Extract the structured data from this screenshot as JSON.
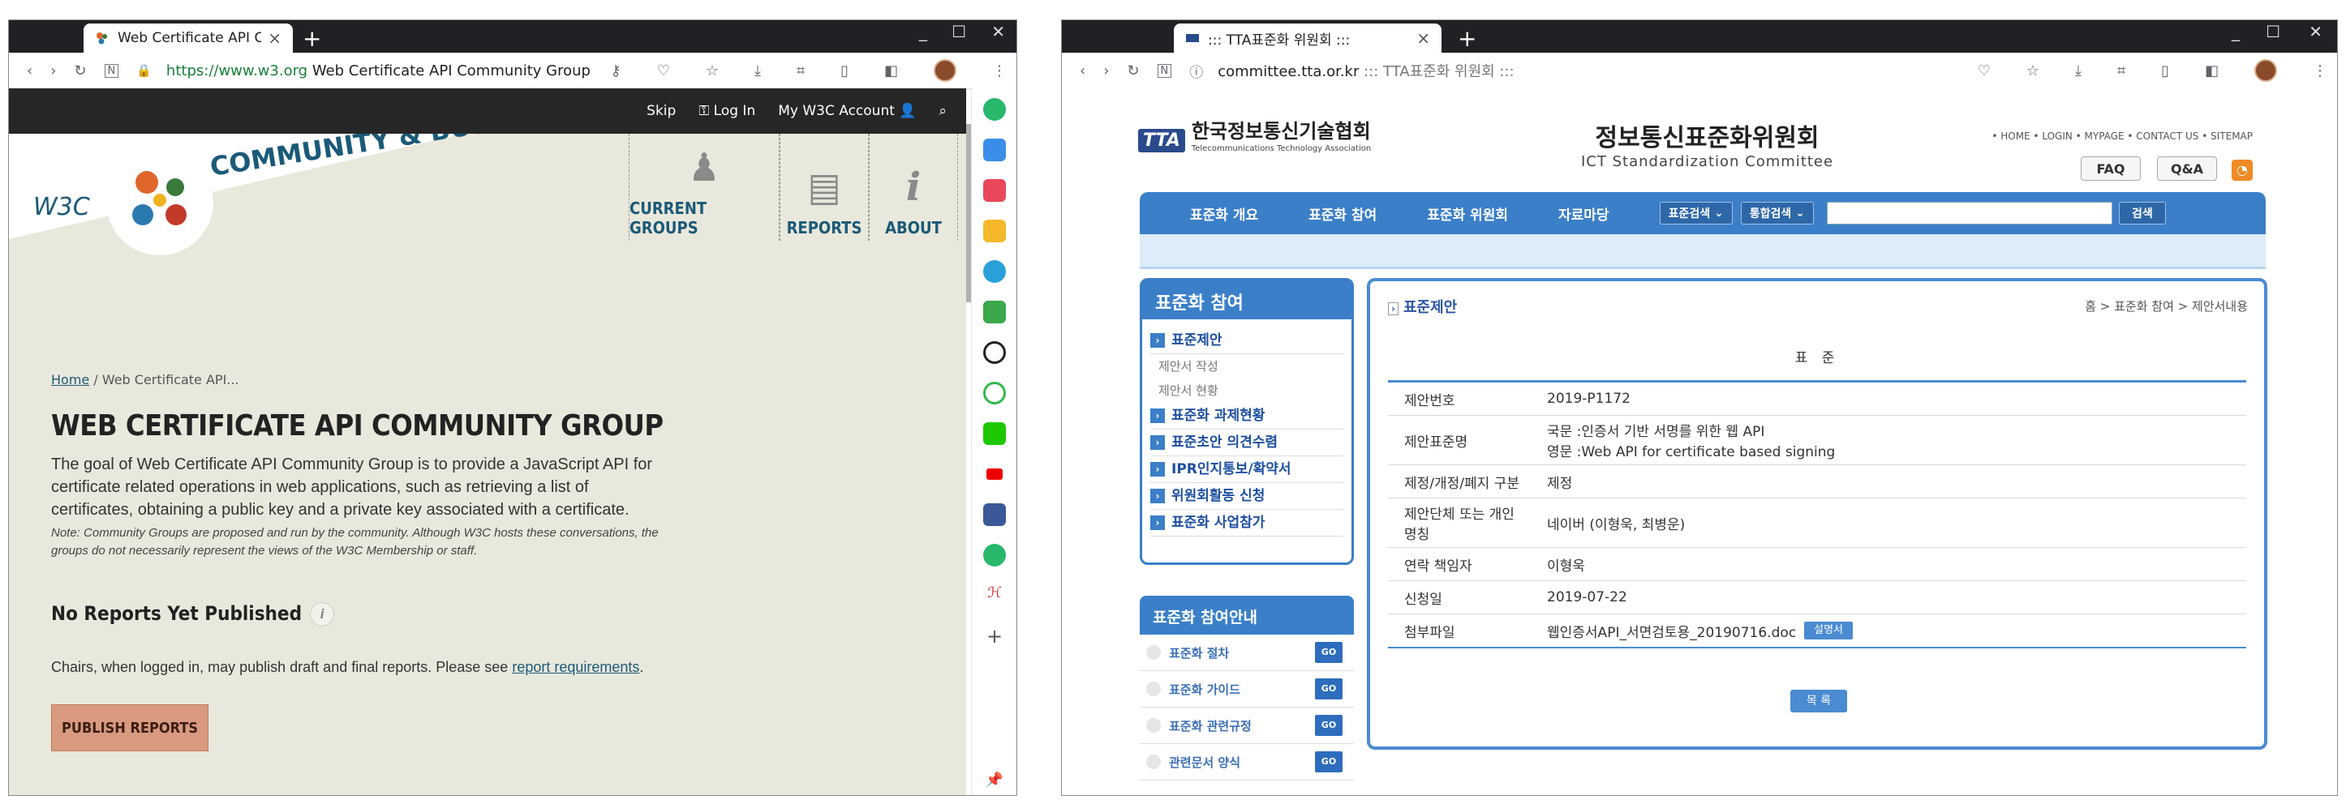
{
  "left_browser": {
    "tab_title": "Web Certificate API Comm",
    "url_host": "https://www.w3.org",
    "url_title": "Web Certificate API Community Group",
    "topbar": {
      "skip": "Skip",
      "login": "Log In",
      "account": "My W3C Account"
    },
    "banner_text": "COMMUNITY & BUSINESS",
    "w3c_logo": "W3C",
    "nav": [
      "CURRENT GROUPS",
      "REPORTS",
      "ABOUT"
    ],
    "breadcrumb": {
      "home": "Home",
      "rest": " / Web Certificate API..."
    },
    "title": "WEB CERTIFICATE API COMMUNITY GROUP",
    "description": "The goal of Web Certificate API Community Group is to provide a JavaScript API for certificate related operations in web applications, such as retrieving a list of certificates, obtaining a public key and a private key associated with a certificate.",
    "note": "Note: Community Groups are proposed and run by the community. Although W3C hosts these conversations, the groups do not necessarily represent the views of the W3C Membership or staff.",
    "reports_heading": "No Reports Yet Published",
    "chairs_text": "Chairs, when logged in, may publish draft and final reports. Please see ",
    "chairs_link": "report requirements",
    "chairs_end": ".",
    "publish_button": "PUBLISH REPORTS"
  },
  "right_browser": {
    "tab_title": "::: TTA표준화 위원회 :::",
    "url_host": "committee.tta.or.kr",
    "url_title": "::: TTA표준화 위원회 :::",
    "logo_mark": "TTA",
    "logo_name": "한국정보통신기술협회",
    "logo_eng": "Telecommunications Technology Association",
    "site_title_ko": "정보통신표준화위원회",
    "site_title_en": "ICT Standardization Committee",
    "top_links": "• HOME  • LOGIN  • MYPAGE  • CONTACT US  • SITEMAP",
    "faq": "FAQ",
    "qna": "Q&A",
    "nav": [
      "표준화 개요",
      "표준화 참여",
      "표준화 위원회",
      "자료마당"
    ],
    "search_select1": "표준검색",
    "search_select2": "통합검색",
    "search_button": "검색",
    "left_menu_title": "표준화 참여",
    "left_menu": {
      "m1": "표준제안",
      "s1": "제안서 작성",
      "s2": "제안서 현황",
      "m2": "표준화 과제현황",
      "m3": "표준초안 의견수렴",
      "m4": "IPR인지통보/확약서",
      "m5": "위원회활동 신청",
      "m6": "표준화 사업참가"
    },
    "guide_title": "표준화 참여안내",
    "guide_items": [
      "표준화 절차",
      "표준화 가이드",
      "표준화 관련규정",
      "관련문서 양식"
    ],
    "go_label": "GO",
    "content_header": "표준제안",
    "content_breadcrumb": "홈 > 표준화 참여 > 제안서내용",
    "section_label": "표 준",
    "rows": [
      {
        "label": "제안번호",
        "value": "2019-P1172"
      },
      {
        "label": "제안표준명",
        "value": "국문 :인증서 기반 서명를 위한 웹 API",
        "value2": "영문 :Web API for certificate based signing"
      },
      {
        "label": "제정/개정/폐지 구분",
        "value": "제정"
      },
      {
        "label": "제안단체 또는 개인 명칭",
        "value": "네이버 (이형욱, 최병운)"
      },
      {
        "label": "연락 책임자",
        "value": "이형욱"
      },
      {
        "label": "신청일",
        "value": "2019-07-22"
      },
      {
        "label": "첨부파일",
        "value": "웹인증서API_서면검토용_20190716.doc",
        "tag": "설명서"
      }
    ],
    "list_button": "목 록"
  }
}
